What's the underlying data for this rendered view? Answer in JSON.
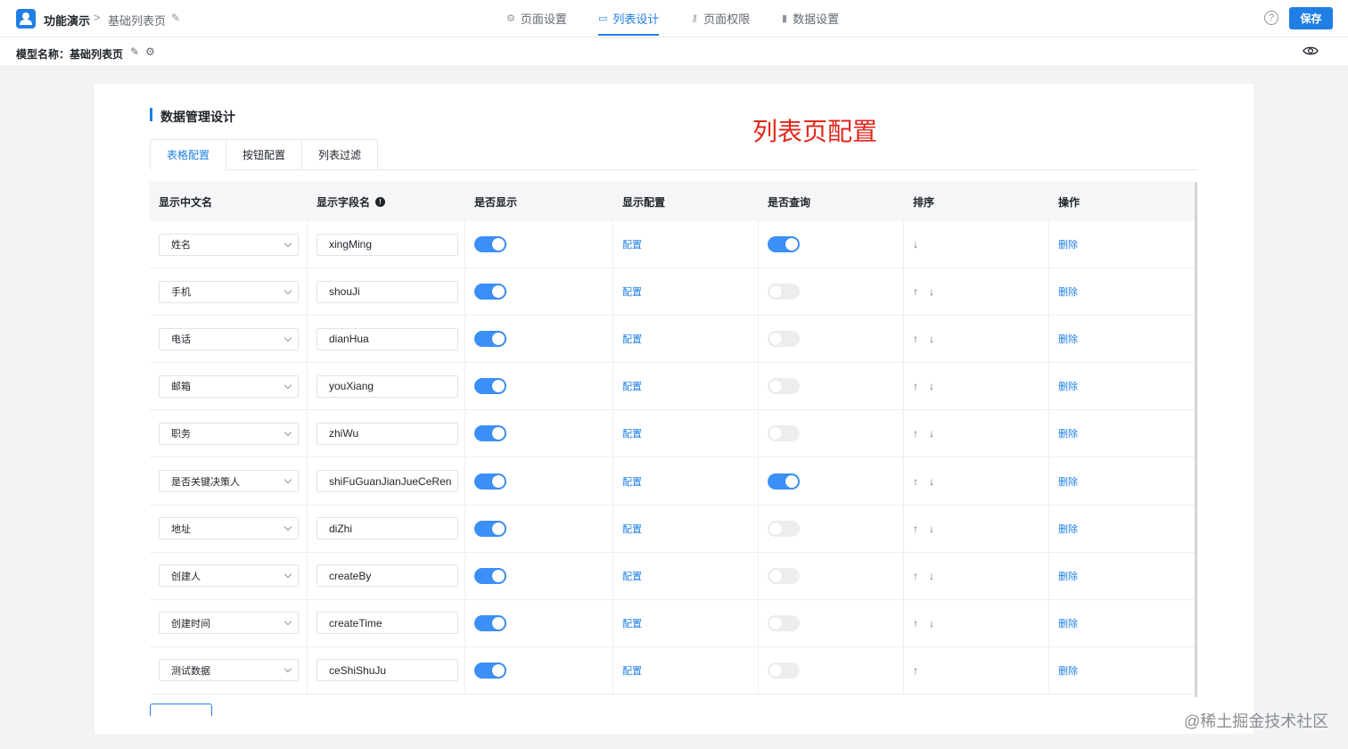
{
  "topbar": {
    "app_name": "功能演示",
    "breadcrumb_sep": ">",
    "page_name": "基础列表页",
    "nav_tabs": [
      {
        "label": "页面设置",
        "icon": "gear-icon"
      },
      {
        "label": "列表设计",
        "icon": "list-design-icon"
      },
      {
        "label": "页面权限",
        "icon": "key-icon"
      },
      {
        "label": "数据设置",
        "icon": "bar-chart-icon"
      }
    ],
    "active_tab": "列表设计",
    "help": "?",
    "save_label": "保存"
  },
  "subbar": {
    "model_label": "模型名称：基础列表页"
  },
  "card": {
    "section_title": "数据管理设计",
    "annotation": "列表页配置",
    "tabs": [
      "表格配置",
      "按钮配置",
      "列表过滤"
    ],
    "active_tab": "表格配置",
    "columns": [
      "显示中文名",
      "显示字段名",
      "是否显示",
      "显示配置",
      "是否查询",
      "排序",
      "操作"
    ],
    "config_label": "配置",
    "delete_label": "删除",
    "rows": [
      {
        "name": "姓名",
        "field": "xingMing",
        "show": true,
        "query": true,
        "up": false,
        "down": true
      },
      {
        "name": "手机",
        "field": "shouJi",
        "show": true,
        "query": false,
        "up": true,
        "down": true
      },
      {
        "name": "电话",
        "field": "dianHua",
        "show": true,
        "query": false,
        "up": true,
        "down": true
      },
      {
        "name": "邮箱",
        "field": "youXiang",
        "show": true,
        "query": false,
        "up": true,
        "down": true
      },
      {
        "name": "职务",
        "field": "zhiWu",
        "show": true,
        "query": false,
        "up": true,
        "down": true
      },
      {
        "name": "是否关键决策人",
        "field": "shiFuGuanJianJueCeRen",
        "show": true,
        "query": true,
        "up": true,
        "down": true
      },
      {
        "name": "地址",
        "field": "diZhi",
        "show": true,
        "query": false,
        "up": true,
        "down": true
      },
      {
        "name": "创建人",
        "field": "createBy",
        "show": true,
        "query": false,
        "up": true,
        "down": true
      },
      {
        "name": "创建时间",
        "field": "createTime",
        "show": true,
        "query": false,
        "up": true,
        "down": true
      },
      {
        "name": "测试数据",
        "field": "ceShiShuJu",
        "show": true,
        "query": false,
        "up": true,
        "down": false
      }
    ]
  },
  "watermark": "@稀土掘金技术社区",
  "colors": {
    "accent": "#1f7fe5",
    "switch_on": "#3b8ff6",
    "annotation": "#e0261b"
  }
}
